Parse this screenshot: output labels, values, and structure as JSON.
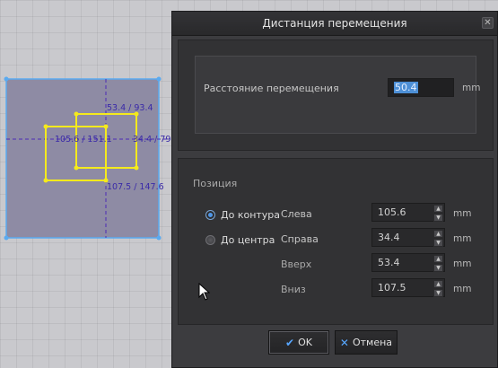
{
  "canvas": {
    "dimensions": {
      "top": "53.4 / 93.4",
      "left": "105.6 / 151.1",
      "right": "34.4 / 79.",
      "bottom": "107.5 / 147.6"
    }
  },
  "dialog": {
    "title": "Дистанция перемещения",
    "close_icon": "close-icon",
    "distance": {
      "label": "Расстояние перемещения",
      "value": "50.4",
      "unit": "mm"
    },
    "position": {
      "section_label": "Позиция",
      "radio_contour": "До контура",
      "radio_center": "До центра",
      "selected": "До контура",
      "fields": [
        {
          "label": "Слева",
          "value": "105.6",
          "unit": "mm"
        },
        {
          "label": "Справа",
          "value": "34.4",
          "unit": "mm"
        },
        {
          "label": "Вверх",
          "value": "53.4",
          "unit": "mm"
        },
        {
          "label": "Вниз",
          "value": "107.5",
          "unit": "mm"
        }
      ]
    },
    "buttons": {
      "ok": "OK",
      "cancel": "Отмена"
    },
    "colors": {
      "accent": "#57a6ff",
      "selection": "#4d8fd6",
      "shape": "#f5ea1c",
      "outline": "#5aaaf0"
    }
  }
}
